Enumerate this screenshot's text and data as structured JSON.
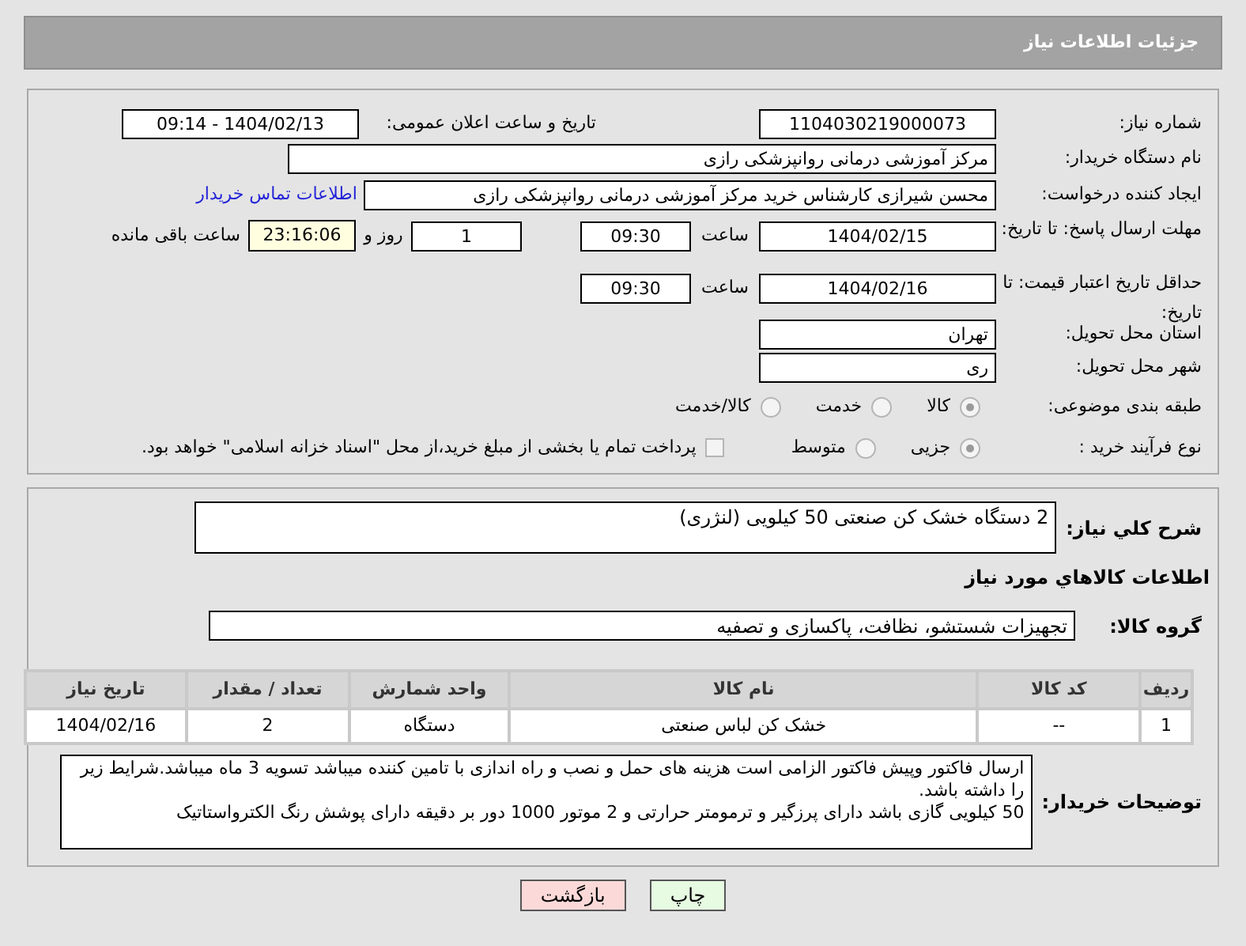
{
  "header": {
    "title": "جزئیات اطلاعات نیاز"
  },
  "need_number": {
    "label": "شماره نیاز:",
    "value": "1104030219000073"
  },
  "announce": {
    "label": "تاریخ و ساعت اعلان عمومی:",
    "value": "1404/02/13 - 09:14"
  },
  "buyer": {
    "label": "نام دستگاه خریدار:",
    "value": "مرکز آموزشی درمانی روانپزشکی رازی"
  },
  "creator": {
    "label": "ایجاد کننده درخواست:",
    "value": "محسن شیرازی کارشناس خرید مرکز آموزشی درمانی روانپزشکی رازی",
    "link": "اطلاعات تماس خریدار"
  },
  "deadline": {
    "label": "مهلت ارسال پاسخ: تا تاریخ:",
    "date": "1404/02/15",
    "time_label": "ساعت",
    "time": "09:30",
    "days": "1",
    "days_label": "روز و",
    "remaining": "23:16:06",
    "remaining_label": "ساعت باقی مانده"
  },
  "validity": {
    "label": "حداقل تاریخ اعتبار قیمت: تا تاریخ:",
    "date": "1404/02/16",
    "time_label": "ساعت",
    "time": "09:30"
  },
  "province": {
    "label": "استان محل تحویل:",
    "value": "تهران"
  },
  "city": {
    "label": "شهر محل تحویل:",
    "value": "ری"
  },
  "category": {
    "label": "طبقه بندی موضوعی:",
    "options": [
      {
        "label": "کالا",
        "selected": true
      },
      {
        "label": "خدمت",
        "selected": false
      },
      {
        "label": "کالا/خدمت",
        "selected": false
      }
    ]
  },
  "process": {
    "label": "نوع فرآیند خرید :",
    "options": [
      {
        "label": "جزیی",
        "selected": true
      },
      {
        "label": "متوسط",
        "selected": false
      }
    ],
    "treasury": {
      "label": "پرداخت تمام یا بخشی از مبلغ خرید،از محل \"اسناد خزانه اسلامی\" خواهد بود.",
      "checked": false
    }
  },
  "summary": {
    "label": "شرح كلي نياز:",
    "value": "2 دستگاه خشک کن صنعتی 50 کیلویی (لنژری)"
  },
  "goods_heading": "اطلاعات كالاهاي مورد نياز",
  "goods_group": {
    "label": "گروه کالا:",
    "value": "تجهیزات شستشو، نظافت، پاکسازی و تصفیه"
  },
  "table": {
    "columns": [
      "ردیف",
      "کد کالا",
      "نام کالا",
      "واحد شمارش",
      "تعداد / مقدار",
      "تاریخ نیاز"
    ],
    "rows": [
      [
        "1",
        "--",
        "خشک کن لباس صنعتی",
        "دستگاه",
        "2",
        "1404/02/16"
      ]
    ]
  },
  "notes": {
    "label": "توضیحات خریدار:",
    "paragraphs": [
      "ارسال فاکتور وپیش فاکتور الزامی است هزینه های حمل و نصب و راه اندازی با تامین کننده میباشد تسویه 3 ماه میباشد.شرایط زیر را داشته باشد.",
      "50 کیلویی  گازی باشد دارای پرزگیر و ترمومتر حرارتی و 2 موتور 1000 دور بر دقیقه دارای پوشش رنگ الکترواستاتیک"
    ]
  },
  "buttons": [
    {
      "label": "چاپ",
      "kind": "print"
    },
    {
      "label": "بازگشت",
      "kind": "back"
    }
  ]
}
